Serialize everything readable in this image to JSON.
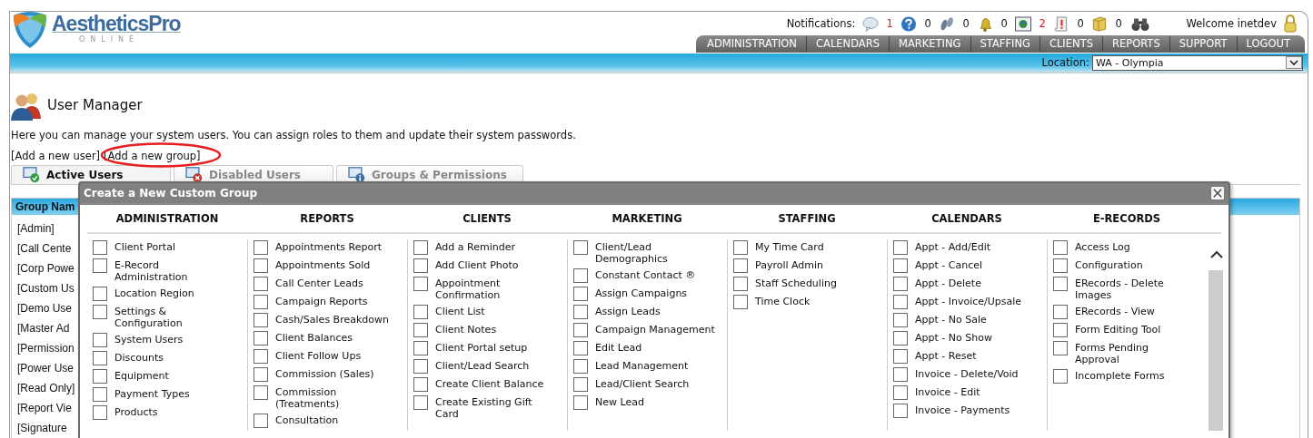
{
  "logo": {
    "name": "AestheticsPro",
    "tagline": "ONLINE"
  },
  "notifications": {
    "label": "Notifications:",
    "items": [
      {
        "kind": "message",
        "count": "1",
        "unread": true
      },
      {
        "kind": "help",
        "count": "0",
        "unread": false
      },
      {
        "kind": "footprints",
        "count": "0",
        "unread": false
      },
      {
        "kind": "bell",
        "count": "0",
        "unread": false
      },
      {
        "kind": "picture",
        "count": "2",
        "unread": true
      },
      {
        "kind": "alert",
        "count": "0",
        "unread": false
      },
      {
        "kind": "package",
        "count": "0",
        "unread": false
      }
    ]
  },
  "welcome": "Welcome inetdev",
  "nav": [
    "ADMINISTRATION",
    "CALENDARS",
    "MARKETING",
    "STAFFING",
    "CLIENTS",
    "REPORTS",
    "SUPPORT",
    "LOGOUT"
  ],
  "location": {
    "label": "Location:",
    "value": "WA - Olympia"
  },
  "page": {
    "title": "User Manager",
    "description": "Here you can manage your system users. You can assign roles to them and update their system passwords.",
    "links": [
      "[Add a new user]",
      "[Add a new group]"
    ]
  },
  "tabs": [
    {
      "label": "Active Users",
      "kind": "active",
      "selected": true
    },
    {
      "label": "Disabled Users",
      "kind": "disabled",
      "selected": false
    },
    {
      "label": "Groups & Permissions",
      "kind": "groups",
      "selected": false
    }
  ],
  "groups": {
    "header": "Group Nam",
    "rows": [
      "[Admin]",
      "[Call Cente",
      "[Corp Powe",
      "[Custom Us",
      "[Demo Use",
      "[Master Ad",
      "[Permission",
      "[Power Use",
      "[Read Only]",
      "[Report Vie",
      "[Signature"
    ]
  },
  "dialog": {
    "title": "Create a New Custom Group",
    "columns": [
      {
        "heading": "ADMINISTRATION",
        "items": [
          {
            "label": "Client Portal",
            "checked": false
          },
          {
            "label": "E-Record Administration",
            "checked": false
          },
          {
            "label": "Location Region",
            "checked": false
          },
          {
            "label": "Settings & Configuration",
            "checked": false
          },
          {
            "label": "System Users",
            "checked": false
          },
          {
            "label": "Discounts",
            "checked": false
          },
          {
            "label": "Equipment",
            "checked": false
          },
          {
            "label": "Payment Types",
            "checked": false
          },
          {
            "label": "Products",
            "checked": false
          }
        ]
      },
      {
        "heading": "REPORTS",
        "items": [
          {
            "label": "Appointments Report",
            "checked": false
          },
          {
            "label": "Appointments Sold",
            "checked": false
          },
          {
            "label": "Call Center Leads",
            "checked": false
          },
          {
            "label": "Campaign Reports",
            "checked": false
          },
          {
            "label": "Cash/Sales Breakdown",
            "checked": false
          },
          {
            "label": "Client Balances",
            "checked": false
          },
          {
            "label": "Client Follow Ups",
            "checked": false
          },
          {
            "label": "Commission (Sales)",
            "checked": false
          },
          {
            "label": "Commission (Treatments)",
            "checked": false
          },
          {
            "label": "Consultation",
            "checked": false
          }
        ]
      },
      {
        "heading": "CLIENTS",
        "items": [
          {
            "label": "Add a Reminder",
            "checked": false
          },
          {
            "label": "Add Client Photo",
            "checked": false
          },
          {
            "label": "Appointment Confirmation",
            "checked": false
          },
          {
            "label": "Client List",
            "checked": false
          },
          {
            "label": "Client Notes",
            "checked": false
          },
          {
            "label": "Client Portal setup",
            "checked": false
          },
          {
            "label": "Client/Lead Search",
            "checked": false
          },
          {
            "label": "Create Client Balance",
            "checked": false
          },
          {
            "label": "Create Existing Gift Card",
            "checked": false
          }
        ]
      },
      {
        "heading": "MARKETING",
        "items": [
          {
            "label": "Client/Lead Demographics",
            "checked": false
          },
          {
            "label": "Constant Contact ®",
            "checked": false
          },
          {
            "label": "Assign Campaigns",
            "checked": false
          },
          {
            "label": "Assign Leads",
            "checked": false
          },
          {
            "label": "Campaign Management",
            "checked": false
          },
          {
            "label": "Edit Lead",
            "checked": false
          },
          {
            "label": "Lead Management",
            "checked": false
          },
          {
            "label": "Lead/Client Search",
            "checked": false
          },
          {
            "label": "New Lead",
            "checked": false
          }
        ]
      },
      {
        "heading": "STAFFING",
        "items": [
          {
            "label": "My Time Card",
            "checked": false
          },
          {
            "label": "Payroll Admin",
            "checked": false
          },
          {
            "label": "Staff Scheduling",
            "checked": false
          },
          {
            "label": "Time Clock",
            "checked": false
          }
        ]
      },
      {
        "heading": "CALENDARS",
        "items": [
          {
            "label": "Appt - Add/Edit",
            "checked": false
          },
          {
            "label": "Appt - Cancel",
            "checked": false
          },
          {
            "label": "Appt - Delete",
            "checked": false
          },
          {
            "label": "Appt - Invoice/Upsale",
            "checked": false
          },
          {
            "label": "Appt - No Sale",
            "checked": false
          },
          {
            "label": "Appt - No Show",
            "checked": false
          },
          {
            "label": "Appt - Reset",
            "checked": false
          },
          {
            "label": "Invoice - Delete/Void",
            "checked": false
          },
          {
            "label": "Invoice - Edit",
            "checked": false
          },
          {
            "label": "Invoice - Payments",
            "checked": false
          }
        ]
      },
      {
        "heading": "E-RECORDS",
        "items": [
          {
            "label": "Access Log",
            "checked": false
          },
          {
            "label": "Configuration",
            "checked": false
          },
          {
            "label": "ERecords - Delete Images",
            "checked": false
          },
          {
            "label": "ERecords - View",
            "checked": false
          },
          {
            "label": "Form Editing Tool",
            "checked": false
          },
          {
            "label": "Forms Pending Approval",
            "checked": false
          },
          {
            "label": "Incomplete Forms",
            "checked": false
          }
        ]
      }
    ]
  }
}
